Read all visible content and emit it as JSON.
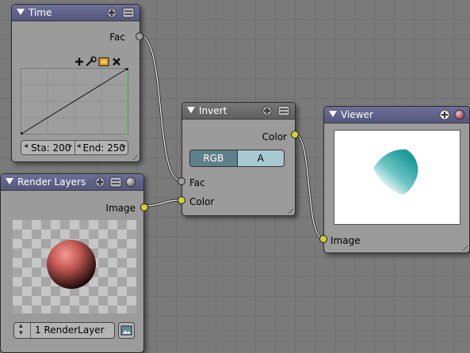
{
  "nodes": {
    "time": {
      "title": "Time",
      "output_fac": "Fac",
      "start_label": "Sta: 200",
      "end_label": "End: 250"
    },
    "render_layers": {
      "title": "Render Layers",
      "output_image": "Image",
      "layer_select": "1 RenderLayer"
    },
    "invert": {
      "title": "Invert",
      "output_color": "Color",
      "toggle_rgb": "RGB",
      "toggle_a": "A",
      "input_fac": "Fac",
      "input_color": "Color"
    },
    "viewer": {
      "title": "Viewer",
      "input_image": "Image"
    }
  },
  "colors": {
    "header_purple": "#6e6f98",
    "header_grey": "#6a6a6a",
    "socket_yellow": "#d0d032",
    "socket_grey": "#a0a0a0",
    "toggle_active": "#5f7f8a",
    "toggle_inactive": "#a7c9d2",
    "link": "#f2f2f2"
  },
  "icons": {
    "collapse": "triangle-down-icon",
    "add": "plus-circle-icon",
    "options": "menu-lines-icon",
    "material": "sphere-icon",
    "curve_tools": [
      "plus-icon",
      "wrench-icon",
      "clip-icon",
      "close-icon"
    ]
  }
}
